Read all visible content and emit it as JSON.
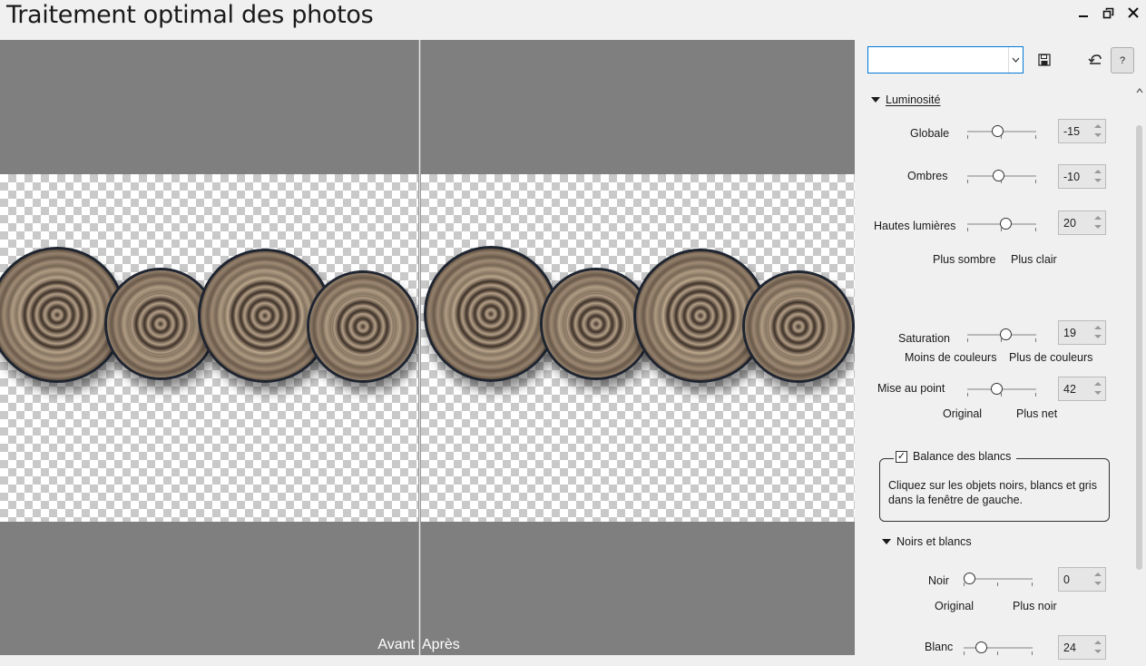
{
  "window": {
    "title": "Traitement optimal des photos"
  },
  "preview": {
    "before_label": "Avant",
    "after_label": "Après"
  },
  "panel": {
    "preset_value": "",
    "help_label": "?",
    "brightness": {
      "header": "Luminosité",
      "global_label": "Globale",
      "global_value": "-15",
      "shadows_label": "Ombres",
      "shadows_value": "-10",
      "highlights_label": "Hautes lumières",
      "highlights_value": "20",
      "darker_label": "Plus sombre",
      "lighter_label": "Plus clair"
    },
    "saturation": {
      "label": "Saturation",
      "value": "19",
      "less_label": "Moins de couleurs",
      "more_label": "Plus de couleurs"
    },
    "focus": {
      "label": "Mise au point",
      "value": "42",
      "original_label": "Original",
      "sharper_label": "Plus net"
    },
    "white_balance": {
      "label": "Balance des blancs",
      "checked": true,
      "description": "Cliquez sur les objets noirs, blancs et gris dans la fenêtre de gauche."
    },
    "black_white": {
      "header": "Noirs et blancs",
      "black_label": "Noir",
      "black_value": "0",
      "original_label": "Original",
      "blacker_label": "Plus noir",
      "white_label": "Blanc",
      "white_value": "24"
    }
  }
}
